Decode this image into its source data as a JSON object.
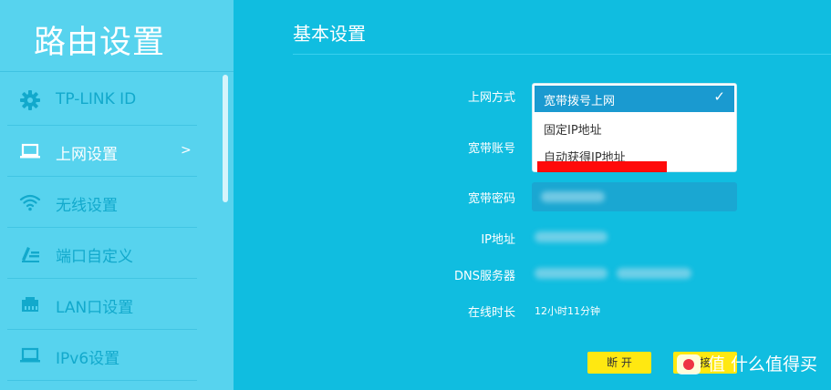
{
  "sidebar": {
    "title": "路由设置",
    "items": [
      {
        "label": "TP-LINK ID",
        "icon": "gear-icon"
      },
      {
        "label": "上网设置",
        "icon": "laptop-icon",
        "arrow": ">"
      },
      {
        "label": "无线设置",
        "icon": "wifi-icon"
      },
      {
        "label": "端口自定义",
        "icon": "edit-icon"
      },
      {
        "label": "LAN口设置",
        "icon": "lan-port-icon"
      },
      {
        "label": "IPv6设置",
        "icon": "laptop-icon"
      }
    ]
  },
  "main": {
    "title": "基本设置",
    "labels": {
      "wan_mode": "上网方式",
      "account": "宽带账号",
      "password": "宽带密码",
      "ip": "IP地址",
      "dns": "DNS服务器",
      "online_time": "在线时长"
    },
    "wan_select": {
      "selected": "宽带拨号上网",
      "options": [
        "固定IP地址",
        "自动获得IP地址"
      ]
    },
    "online_time_value": "12小时11分钟",
    "buttons": {
      "disconnect": "断 开",
      "connect": "接"
    }
  },
  "watermark": {
    "text": "值 什么值得买"
  },
  "colors": {
    "sidebar_bg": "#57d3ee",
    "main_bg": "#10bde0",
    "accent": "#1a9ad0",
    "button": "#ffe811",
    "highlight_red": "#ff0a0a"
  }
}
